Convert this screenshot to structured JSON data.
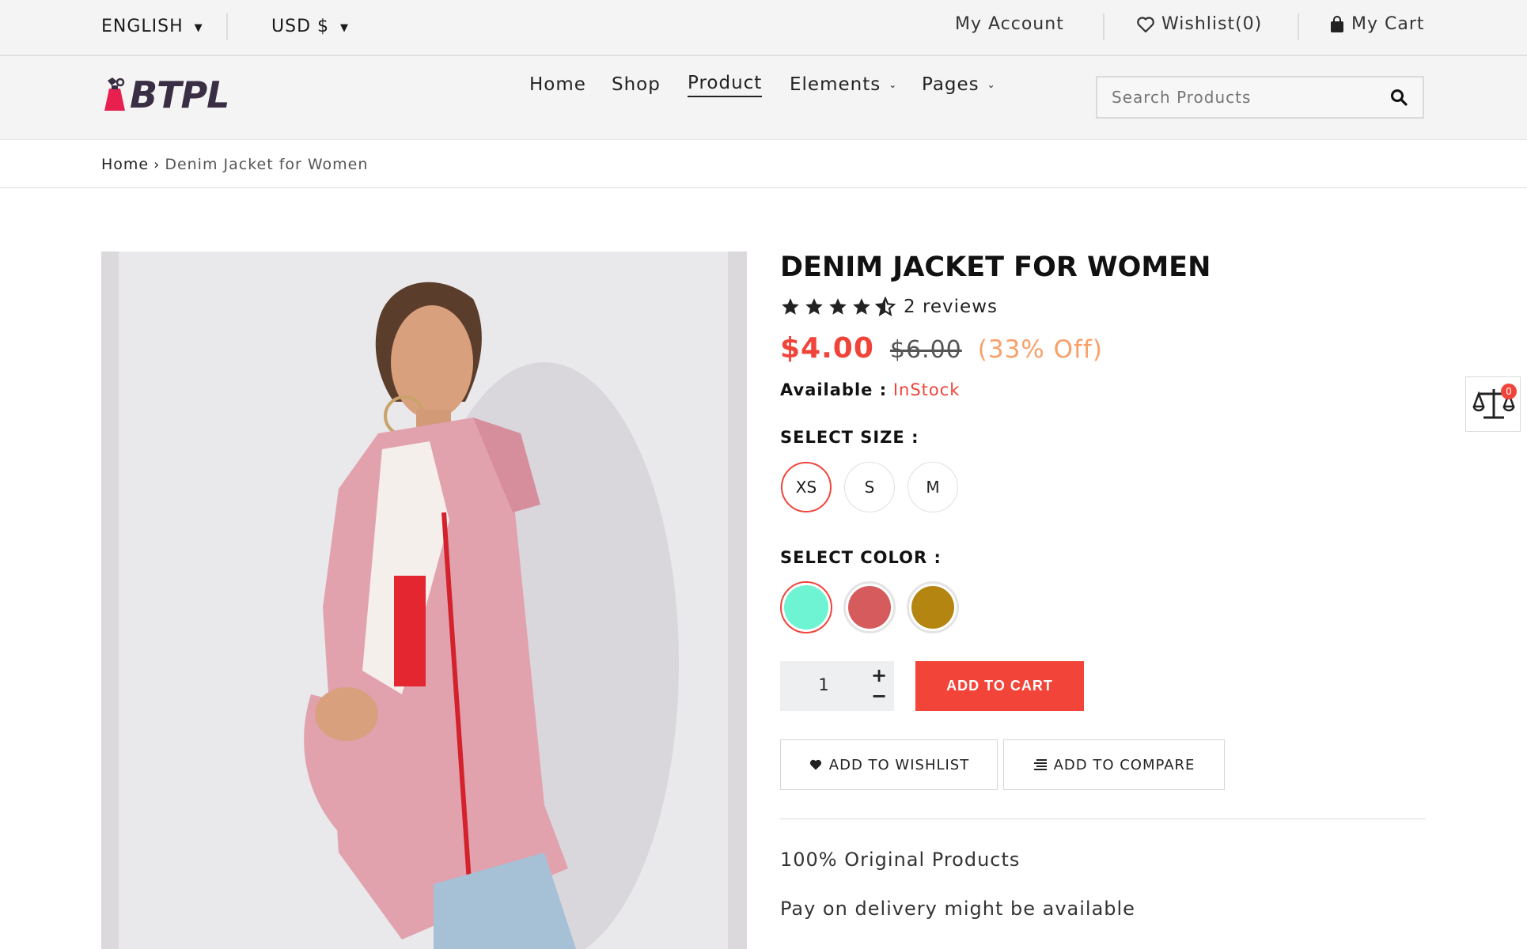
{
  "topbar": {
    "language": "ENGLISH",
    "currency": "USD $",
    "my_account": "My Account",
    "wishlist": "Wishlist(0)",
    "my_cart": "My Cart"
  },
  "header": {
    "logo_text": "BTPL",
    "nav": [
      {
        "label": "Home",
        "active": false,
        "dropdown": false
      },
      {
        "label": "Shop",
        "active": false,
        "dropdown": false
      },
      {
        "label": "Product",
        "active": true,
        "dropdown": false
      },
      {
        "label": "Elements",
        "active": false,
        "dropdown": true
      },
      {
        "label": "Pages",
        "active": false,
        "dropdown": true
      }
    ],
    "search_placeholder": "Search Products"
  },
  "breadcrumb": {
    "home": "Home",
    "current": "Denim Jacket for Women"
  },
  "product": {
    "title": "DENIM JACKET FOR WOMEN",
    "rating": 4.5,
    "reviews": "2 reviews",
    "price": "$4.00",
    "old_price": "$6.00",
    "discount": "(33% Off)",
    "available_label": "Available :",
    "available_value": "InStock",
    "size_label": "SELECT SIZE :",
    "sizes": [
      "XS",
      "S",
      "M"
    ],
    "selected_size": "XS",
    "color_label": "SELECT COLOR :",
    "colors": [
      "#6ef4d3",
      "#d55b5c",
      "#b48510"
    ],
    "selected_color": "#6ef4d3",
    "quantity": "1",
    "add_to_cart": "ADD TO CART",
    "add_to_wishlist": "ADD TO WISHLIST",
    "add_to_compare": "ADD TO COMPARE",
    "features": [
      "100% Original Products",
      "Pay on delivery might be available"
    ]
  },
  "compare_widget": {
    "count": "0"
  },
  "colors": {
    "accent": "#f0443a",
    "discount": "#f7a06a",
    "topbar_bg": "#f4f4f4"
  }
}
